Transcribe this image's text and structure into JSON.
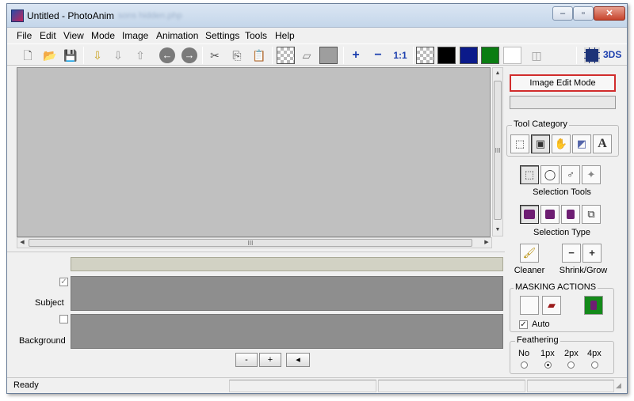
{
  "window": {
    "title": "Untitled - PhotoAnim",
    "ghost_title": "sons hidden.php"
  },
  "window_controls": {
    "minimize": "–",
    "maximize": "▫",
    "close": "✕"
  },
  "menu": [
    "File",
    "Edit",
    "View",
    "Mode",
    "Image",
    "Animation",
    "Settings",
    "Tools",
    "Help"
  ],
  "toolbar": {
    "zoom_in": "+",
    "zoom_out": "−",
    "actual_size": "1:1",
    "brand": "3DS",
    "swatch_colors": {
      "black": "#000000",
      "navy": "#0b1a8a",
      "green": "#0a7d12",
      "white": "#ffffff"
    }
  },
  "canvas": {
    "background": "#c0c0c0"
  },
  "scroll": {
    "grip": "III"
  },
  "tracks": {
    "subject_label": "Subject",
    "background_label": "Background",
    "subject_checked": true,
    "background_checked": false,
    "controls": {
      "minus": "-",
      "plus": "+",
      "prev": "◂"
    }
  },
  "right_panel": {
    "mode_button": "Image Edit Mode",
    "tool_category_title": "Tool Category",
    "tool_category_icons": [
      "rectangle-select-icon",
      "image-frame-icon",
      "hand-pointer-icon",
      "eraser-tool-icon",
      "text-tool-icon"
    ],
    "tool_category_text_glyph": "A",
    "selection_tools_caption": "Selection Tools",
    "selection_type_caption": "Selection Type",
    "cleaner_caption": "Cleaner",
    "shrink_grow_caption": "Shrink/Grow",
    "shrink": "−",
    "grow": "+",
    "masking_title": "MASKING ACTIONS",
    "auto_label": "Auto",
    "auto_checked": true,
    "feathering_title": "Feathering",
    "feathering_options": [
      "No",
      "1px",
      "2px",
      "4px"
    ],
    "feathering_selected": "1px"
  },
  "status": {
    "text": "Ready"
  }
}
